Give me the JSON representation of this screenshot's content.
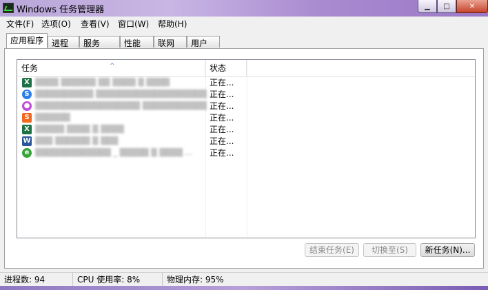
{
  "window": {
    "title": "Windows 任务管理器",
    "minimize_glyph": "▁",
    "maximize_glyph": "□",
    "close_glyph": "✕"
  },
  "menu": [
    "文件(F)",
    "选项(O)",
    "查看(V)",
    "窗口(W)",
    "帮助(H)"
  ],
  "tabs": [
    "应用程序",
    "进程",
    "服务",
    "性能",
    "联网",
    "用户"
  ],
  "active_tab": "应用程序",
  "task_list": {
    "columns": [
      "任务",
      "状态"
    ],
    "sort_indicator": "^",
    "rows": [
      {
        "icon": "excel-icon",
        "icon_glyph": "X",
        "icon_color": "#1e7145",
        "name": "▒▒▒▒ ▒▒▒▒▒▒ ▒▒ ▒▒▒▒ ▒ ▒▒▒▒",
        "status": "正在..."
      },
      {
        "icon": "browser-s-icon",
        "icon_glyph": "S",
        "icon_color": "#2b7de9",
        "name": "▒▒▒▒▒▒▒▒▒▒ ▒▒▒▒▒▒▒▒▒▒▒▒▒▒▒▒▒▒▒ ...",
        "status": "正在..."
      },
      {
        "icon": "color-circle-icon",
        "icon_glyph": "●",
        "icon_color": "#c04ad8",
        "name": "▒▒▒▒▒▒▒▒▒▒▒▒▒▒▒▒▒▒ ▒▒▒▒▒▒▒▒▒▒▒",
        "status": "正在..."
      },
      {
        "icon": "sogou-s-icon",
        "icon_glyph": "S",
        "icon_color": "#f0691f",
        "name": "▒▒▒▒▒▒",
        "status": "正在..."
      },
      {
        "icon": "excel-icon",
        "icon_glyph": "X",
        "icon_color": "#1e7145",
        "name": "▒▒▒▒▒ ▒▒▒▒ ▒ ▒▒▒▒",
        "status": "正在..."
      },
      {
        "icon": "word-icon",
        "icon_glyph": "W",
        "icon_color": "#2b579a",
        "name": "▒▒▒ ▒▒▒▒▒▒ ▒ ▒▒▒",
        "status": "正在..."
      },
      {
        "icon": "ie-icon",
        "icon_glyph": "e",
        "icon_color": "#37a43a",
        "name": "▒▒▒▒▒▒▒▒▒▒▒▒▒ _ ▒▒▒▒▒ ▒ ▒▒▒▒ ...",
        "status": "正在..."
      }
    ]
  },
  "buttons": {
    "end_task": "结束任务(E)",
    "switch_to": "切换至(S)",
    "new_task": "新任务(N)..."
  },
  "status_bar": {
    "processes": "进程数: 94",
    "cpu": "CPU 使用率: 8%",
    "memory": "物理内存: 95%"
  }
}
